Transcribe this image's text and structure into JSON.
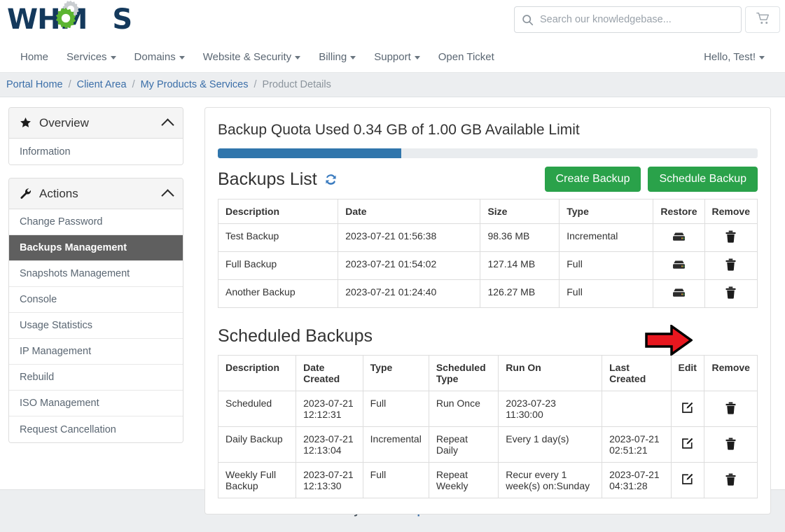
{
  "header": {
    "logo_text_left": "WHM",
    "logo_text_right": "S",
    "logo_alt": "WHMCS",
    "search_placeholder": "Search our knowledgebase...",
    "search_value": "",
    "search_icon": "search-icon",
    "cart_icon": "shopping-cart-icon"
  },
  "nav": {
    "items": [
      {
        "label": "Home",
        "has_caret": false
      },
      {
        "label": "Services",
        "has_caret": true
      },
      {
        "label": "Domains",
        "has_caret": true
      },
      {
        "label": "Website & Security",
        "has_caret": true
      },
      {
        "label": "Billing",
        "has_caret": true
      },
      {
        "label": "Support",
        "has_caret": true
      },
      {
        "label": "Open Ticket",
        "has_caret": false
      }
    ],
    "account_label": "Hello, Test!"
  },
  "breadcrumb": {
    "items": [
      "Portal Home",
      "Client Area",
      "My Products & Services"
    ],
    "current": "Product Details",
    "separator": "/"
  },
  "sidebar": {
    "panels": [
      {
        "title": "Overview",
        "icon": "star-icon",
        "collapse_icon": "chevron-up-icon",
        "items": [
          {
            "label": "Information",
            "active": false
          }
        ]
      },
      {
        "title": "Actions",
        "icon": "wrench-icon",
        "collapse_icon": "chevron-up-icon",
        "items": [
          {
            "label": "Change Password",
            "active": false
          },
          {
            "label": "Backups Management",
            "active": true
          },
          {
            "label": "Snapshots Management",
            "active": false
          },
          {
            "label": "Console",
            "active": false
          },
          {
            "label": "Usage Statistics",
            "active": false
          },
          {
            "label": "IP Management",
            "active": false
          },
          {
            "label": "Rebuild",
            "active": false
          },
          {
            "label": "ISO Management",
            "active": false
          },
          {
            "label": "Request Cancellation",
            "active": false
          }
        ]
      }
    ]
  },
  "main": {
    "quota_title": "Backup Quota Used 0.34 GB of 1.00 GB Available Limit",
    "quota_used_gb": "0.34",
    "quota_limit_gb": "1.00",
    "progress_percent": 34,
    "backups_list_title": "Backups List",
    "refresh_icon": "refresh-icon",
    "create_backup_label": "Create Backup",
    "schedule_backup_label": "Schedule Backup",
    "backups_table": {
      "columns": [
        "Description",
        "Date",
        "Size",
        "Type",
        "Restore",
        "Remove"
      ],
      "rows": [
        {
          "description": "Test Backup",
          "date": "2023-07-21 01:56:38",
          "size": "98.36 MB",
          "type": "Incremental",
          "restore_icon": "server-restore-icon",
          "remove_icon": "trash-icon"
        },
        {
          "description": "Full Backup",
          "date": "2023-07-21 01:54:02",
          "size": "127.14 MB",
          "type": "Full",
          "restore_icon": "server-restore-icon",
          "remove_icon": "trash-icon"
        },
        {
          "description": "Another Backup",
          "date": "2023-07-21 01:24:40",
          "size": "126.27 MB",
          "type": "Full",
          "restore_icon": "server-restore-icon",
          "remove_icon": "trash-icon"
        }
      ]
    },
    "scheduled_title": "Scheduled Backups",
    "scheduled_table": {
      "columns": [
        "Description",
        "Date Created",
        "Type",
        "Scheduled Type",
        "Run On",
        "Last Created",
        "Edit",
        "Remove"
      ],
      "rows": [
        {
          "description": "Scheduled",
          "date_created": "2023-07-21 12:12:31",
          "type": "Full",
          "scheduled_type": "Run Once",
          "run_on": "2023-07-23 11:30:00",
          "last_created": "",
          "edit_icon": "edit-pencil-icon",
          "remove_icon": "trash-icon"
        },
        {
          "description": "Daily Backup",
          "date_created": "2023-07-21 12:13:04",
          "type": "Incremental",
          "scheduled_type": "Repeat Daily",
          "run_on": "Every 1 day(s)",
          "last_created": "2023-07-21 02:51:21",
          "edit_icon": "edit-pencil-icon",
          "remove_icon": "trash-icon"
        },
        {
          "description": "Weekly Full Backup",
          "date_created": "2023-07-21 12:13:30",
          "type": "Full",
          "scheduled_type": "Repeat Weekly",
          "run_on": "Recur every 1 week(s) on:Sunday",
          "last_created": "2023-07-21 04:31:28",
          "edit_icon": "edit-pencil-icon",
          "remove_icon": "trash-icon"
        }
      ]
    }
  },
  "footer": {
    "powered_by": "Powered by",
    "link_label": "WHMCompleteSolution"
  },
  "annotation": {
    "arrow": "red-arrow-pointer",
    "points_at": "restore-icon-row-1"
  },
  "colors": {
    "brand_navy": "#14395c",
    "brand_green": "#5cb531",
    "link_blue": "#3a6ea8",
    "progress_blue": "#3176ac",
    "button_green": "#2aa24a",
    "active_gray": "#5f5f5f",
    "annotation_red": "#e8171f"
  }
}
